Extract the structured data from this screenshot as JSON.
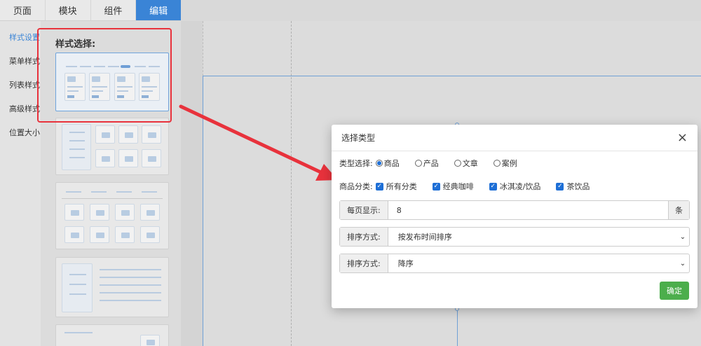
{
  "tabs": [
    {
      "label": "页面"
    },
    {
      "label": "模块"
    },
    {
      "label": "组件"
    },
    {
      "label": "编辑"
    }
  ],
  "side_menu": [
    {
      "label": "样式设置"
    },
    {
      "label": "菜单样式"
    },
    {
      "label": "列表样式"
    },
    {
      "label": "高级样式"
    },
    {
      "label": "位置大小"
    }
  ],
  "style_panel": {
    "title": "样式选择:"
  },
  "modal": {
    "title": "选择类型",
    "close": "×",
    "type_label": "类型选择:",
    "type_options": [
      {
        "label": "商品",
        "selected": true
      },
      {
        "label": "产品",
        "selected": false
      },
      {
        "label": "文章",
        "selected": false
      },
      {
        "label": "案例",
        "selected": false
      }
    ],
    "category_label": "商品分类:",
    "categories": [
      {
        "label": "所有分类",
        "checked": true
      },
      {
        "label": "经典咖啡",
        "checked": true
      },
      {
        "label": "冰淇凌/饮品",
        "checked": true
      },
      {
        "label": "茶饮品",
        "checked": true
      }
    ],
    "per_page": {
      "label": "每页显示:",
      "value": "8",
      "unit": "条"
    },
    "sort": {
      "label": "排序方式:",
      "value": "按发布时间排序"
    },
    "order": {
      "label": "排序方式:",
      "value": "降序"
    },
    "confirm": "确定"
  },
  "colors": {
    "accent": "#3a84d6",
    "highlight_red": "#e8323c",
    "confirm_green": "#4cae4c"
  }
}
